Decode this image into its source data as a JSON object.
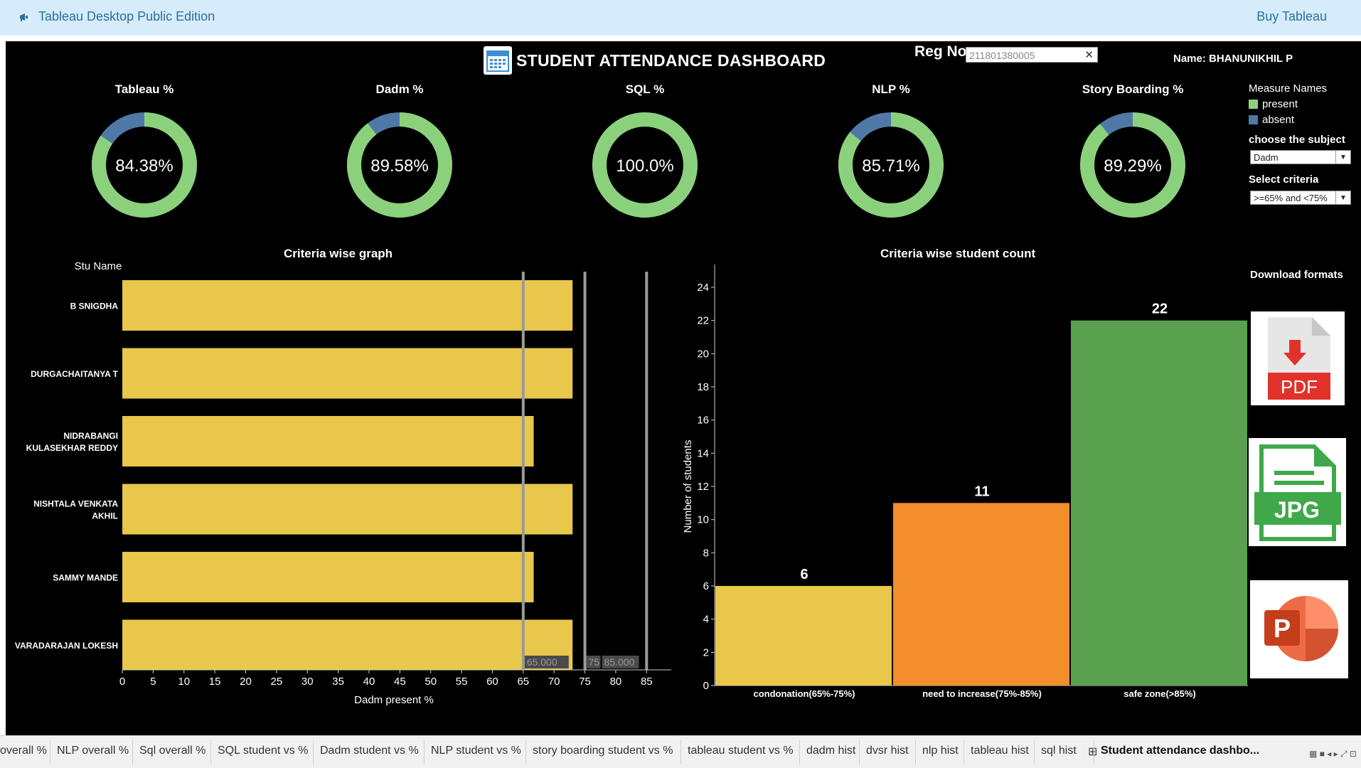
{
  "topbar": {
    "app_title": "Tableau Desktop Public Edition",
    "buy_label": "Buy Tableau"
  },
  "dashboard": {
    "title": "STUDENT ATTENDANCE DASHBOARD",
    "regno_label": "Reg No",
    "regno_value": "211801380005",
    "name_label": "Name: BHANUNIKHIL P"
  },
  "donuts": [
    {
      "title": "Tableau %",
      "label": "84.38%",
      "present": 84.38
    },
    {
      "title": "Dadm %",
      "label": "89.58%",
      "present": 89.58
    },
    {
      "title": "SQL %",
      "label": "100.0%",
      "present": 100.0
    },
    {
      "title": "NLP %",
      "label": "85.71%",
      "present": 85.71
    },
    {
      "title": "Story Boarding %",
      "label": "89.29%",
      "present": 89.29
    }
  ],
  "legend": {
    "title": "Measure Names",
    "items": [
      "present",
      "absent"
    ]
  },
  "controls": {
    "subject_label": "choose the subject",
    "subject_value": "Dadm",
    "criteria_label": "Select criteria",
    "criteria_value": ">=65% and <75%"
  },
  "colors": {
    "present": "#8bd17c",
    "absent": "#4e79a7",
    "yellow": "#e8c74b",
    "orange": "#f28e2b",
    "green": "#59a14f"
  },
  "charts": {
    "left_title": "Criteria wise graph",
    "right_title": "Criteria wise student count"
  },
  "download": {
    "title": "Download formats",
    "formats": [
      "PDF",
      "JPG",
      "PPT"
    ]
  },
  "tabs": [
    "overall %",
    "NLP overall %",
    "Sql overall %",
    "SQL student vs %",
    "Dadm student vs %",
    "NLP student vs %",
    "story boarding student vs %",
    "tableau student vs %",
    "dadm hist",
    "dvsr hist",
    "nlp hist",
    "tableau hist",
    "sql hist",
    "Student attendance dashbo..."
  ],
  "chart_data": [
    {
      "type": "bar",
      "orientation": "horizontal",
      "title": "Criteria wise graph",
      "ylabel": "Stu Name",
      "xlabel": "Dadm present %",
      "categories": [
        "B SNIGDHA",
        "DURGACHAITANYA T",
        "NIDRABANGI KULASEKHAR REDDY",
        "NISHTALA VENKATA AKHIL",
        "SAMMY MANDE",
        "VARADARAJAN LOKESH"
      ],
      "values": [
        73,
        73,
        66.7,
        73,
        66.7,
        73
      ],
      "xlim": [
        0,
        89
      ],
      "xticks": [
        0,
        5,
        10,
        15,
        20,
        25,
        30,
        35,
        40,
        45,
        50,
        55,
        60,
        65,
        70,
        75,
        80,
        85
      ],
      "reference_lines": [
        65,
        75,
        85
      ],
      "reference_labels": [
        "65.000",
        "75",
        "85.000"
      ]
    },
    {
      "type": "bar",
      "title": "Criteria wise student count",
      "ylabel": "Number of students",
      "categories": [
        "condonation(65%-75%)",
        "need to increase(75%-85%)",
        "safe zone(>85%)"
      ],
      "values": [
        6,
        11,
        22
      ],
      "ylim": [
        0,
        24
      ],
      "yticks": [
        0,
        2,
        4,
        6,
        8,
        10,
        12,
        14,
        16,
        18,
        20,
        22,
        24
      ]
    }
  ]
}
